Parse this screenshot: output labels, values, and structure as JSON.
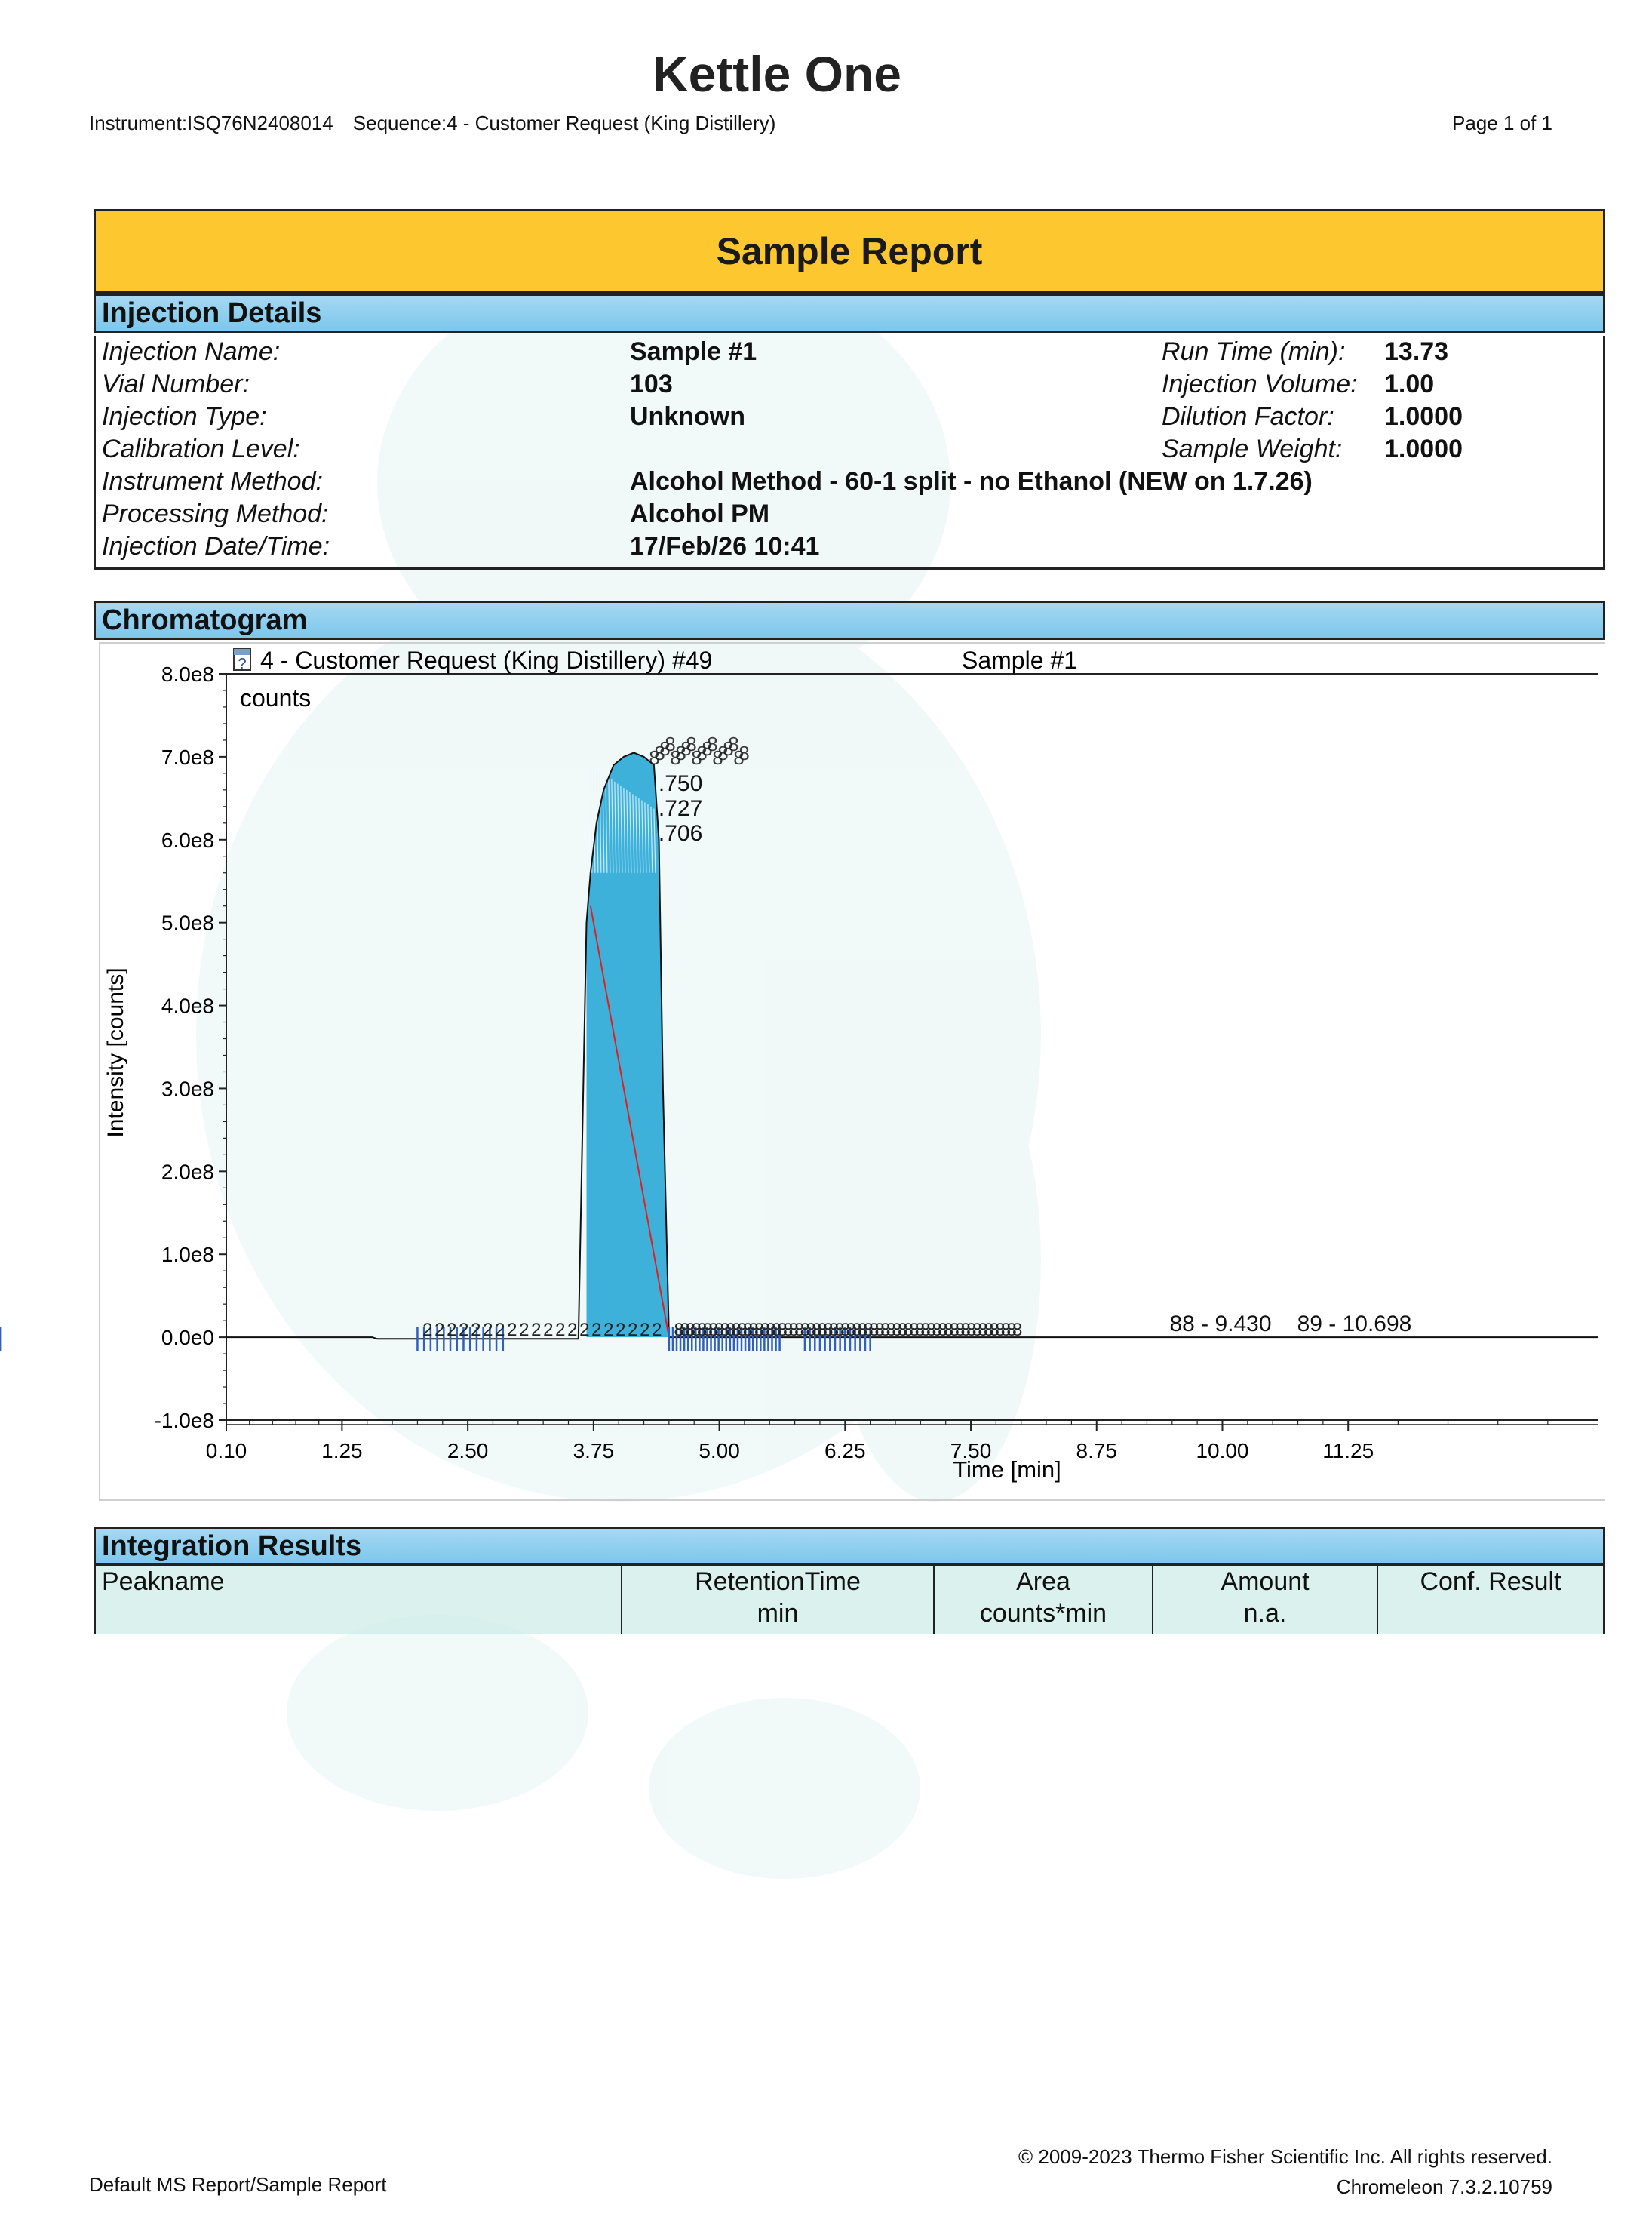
{
  "header": {
    "title": "Kettle One",
    "instrument": "Instrument:ISQ76N2408014",
    "sequence": "Sequence:4 - Customer Request (King Distillery)",
    "page": "Page 1 of 1"
  },
  "report_title": "Sample Report",
  "injection_details": {
    "heading": "Injection Details",
    "rows": [
      {
        "label": "Injection Name:",
        "value": "Sample #1",
        "label2": "Run Time (min):",
        "value2": "13.73"
      },
      {
        "label": "Vial Number:",
        "value": "103",
        "label2": "Injection Volume:",
        "value2": "1.00"
      },
      {
        "label": "Injection Type:",
        "value": "Unknown",
        "label2": "Dilution Factor:",
        "value2": "1.0000"
      },
      {
        "label": "Calibration Level:",
        "value": "",
        "label2": "Sample Weight:",
        "value2": "1.0000"
      },
      {
        "label": "Instrument Method:",
        "value": "Alcohol Method - 60-1 split - no Ethanol (NEW on 1.7.26)",
        "label2": "",
        "value2": ""
      },
      {
        "label": "Processing Method:",
        "value": "Alcohol PM",
        "label2": "",
        "value2": ""
      },
      {
        "label": "Injection Date/Time:",
        "value": "17/Feb/26 10:41",
        "label2": "",
        "value2": ""
      }
    ]
  },
  "chromatogram": {
    "heading": "Chromatogram",
    "trace_title": "4 - Customer Request (King Distillery) #49",
    "sample_label": "Sample #1",
    "units_label": "counts",
    "help_icon": "question-box-icon"
  },
  "chart_data": {
    "type": "line",
    "xlabel": "Time [min]",
    "ylabel": "Intensity [counts]",
    "xlim": [
      0.1,
      13.73
    ],
    "ylim": [
      -100000000.0,
      800000000.0
    ],
    "x_ticks": [
      0.1,
      1.25,
      2.5,
      3.75,
      5.0,
      6.25,
      7.5,
      8.75,
      10.0,
      11.25
    ],
    "x_tick_labels": [
      "0.10",
      "1.25",
      "2.50",
      "3.75",
      "5.00",
      "6.25",
      "7.50",
      "8.75",
      "10.00",
      "11.25"
    ],
    "y_ticks": [
      -100000000.0,
      0,
      100000000.0,
      200000000.0,
      300000000.0,
      400000000.0,
      500000000.0,
      600000000.0,
      700000000.0,
      800000000.0
    ],
    "y_tick_labels": [
      "-1.0e8",
      "0.0e0",
      "1.0e8",
      "2.0e8",
      "3.0e8",
      "4.0e8",
      "5.0e8",
      "6.0e8",
      "7.0e8",
      "8.0e8"
    ],
    "series": [
      {
        "x": [
          0.1,
          1.35,
          1.55,
          1.6,
          2.0,
          3.0,
          3.6,
          3.68,
          3.72,
          3.78,
          3.85,
          3.95,
          4.05,
          4.15,
          4.25,
          4.35,
          4.4,
          4.44,
          4.5,
          5.0,
          6.0,
          7.0,
          8.0,
          9.0,
          9.43,
          10.0,
          10.698,
          11.0,
          12.0,
          13.73
        ],
        "y": [
          0,
          0,
          0,
          -2000000,
          -2000000,
          -2000000,
          -2000000,
          500000000,
          560000000,
          620000000,
          660000000,
          690000000,
          700000000,
          705000000,
          700000000,
          690000000,
          600000000,
          300000000,
          0,
          0,
          0,
          0,
          0,
          0,
          0,
          0,
          0,
          0,
          0,
          0
        ]
      }
    ],
    "peak_annotations": [
      {
        "x": 4.35,
        "y": 610000000,
        "label": ".706"
      },
      {
        "x": 4.35,
        "y": 640000000,
        "label": ".727"
      },
      {
        "x": 4.35,
        "y": 670000000,
        "label": ".750"
      },
      {
        "x": 9.43,
        "y": 0,
        "label": "88 - 9.430"
      },
      {
        "x": 10.698,
        "y": 0,
        "label": "89 - 10.698"
      }
    ],
    "grid": false,
    "legend": "none"
  },
  "integration_results": {
    "heading": "Integration Results",
    "columns": [
      {
        "line1": "Peakname",
        "line2": ""
      },
      {
        "line1": "RetentionTime",
        "line2": "min"
      },
      {
        "line1": "Area",
        "line2": "counts*min"
      },
      {
        "line1": "Amount",
        "line2": "n.a."
      },
      {
        "line1": "Conf. Result",
        "line2": ""
      }
    ]
  },
  "footer": {
    "left": "Default MS Report/Sample Report",
    "copyright": "© 2009-2023 Thermo Fisher Scientific Inc. All rights reserved.",
    "version": "Chromeleon 7.3.2.10759"
  }
}
